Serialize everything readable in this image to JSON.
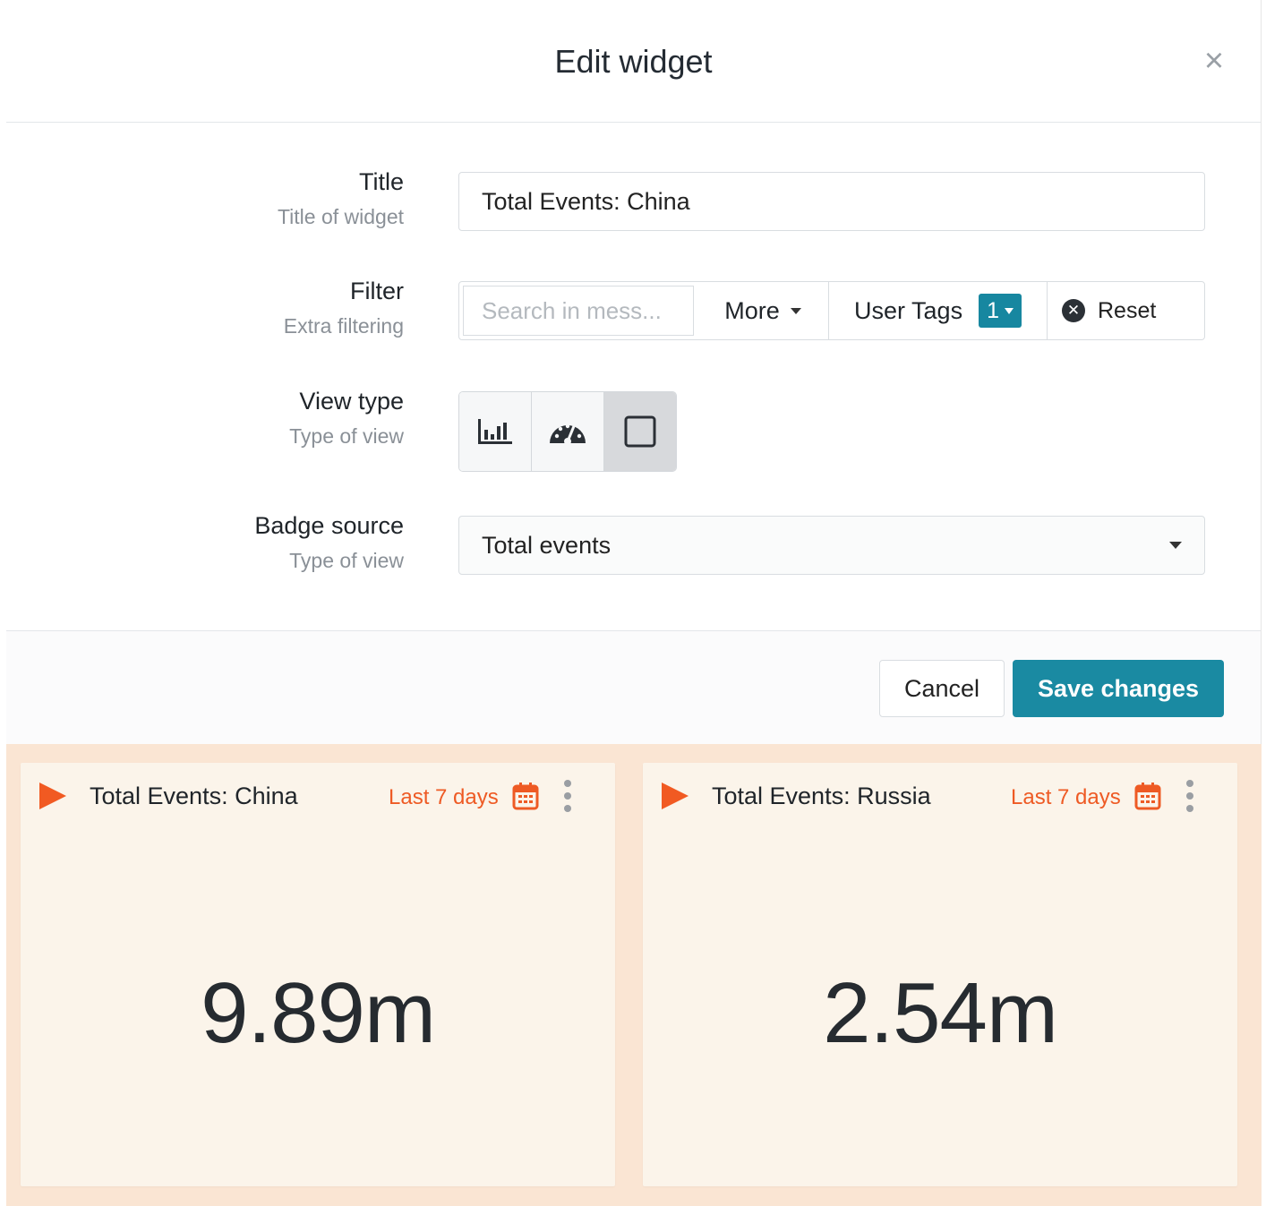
{
  "modal": {
    "title": "Edit widget",
    "close_glyph": "×"
  },
  "form": {
    "title": {
      "label": "Title",
      "help": "Title of widget",
      "value": "Total Events: China"
    },
    "filter": {
      "label": "Filter",
      "help": "Extra filtering",
      "search_placeholder": "Search in mess...",
      "more_label": "More",
      "user_tags_label": "User Tags",
      "user_tags_count": "1",
      "reset_label": "Reset"
    },
    "view_type": {
      "label": "View type",
      "help": "Type of view",
      "options": [
        {
          "icon": "bar-chart-icon",
          "selected": false
        },
        {
          "icon": "gauge-icon",
          "selected": false
        },
        {
          "icon": "square-icon",
          "selected": true
        }
      ]
    },
    "badge_source": {
      "label": "Badge source",
      "help": "Type of view",
      "value": "Total events"
    }
  },
  "footer": {
    "cancel_label": "Cancel",
    "save_label": "Save changes"
  },
  "widgets": [
    {
      "title": "Total Events: China",
      "range": "Last 7 days",
      "value": "9.89m"
    },
    {
      "title": "Total Events: Russia",
      "range": "Last 7 days",
      "value": "2.54m"
    }
  ],
  "colors": {
    "accent_orange": "#f15a22",
    "primary_teal": "#1a8aa2",
    "dashboard_bg": "#fae5d3",
    "card_bg": "#fbf4ea"
  }
}
